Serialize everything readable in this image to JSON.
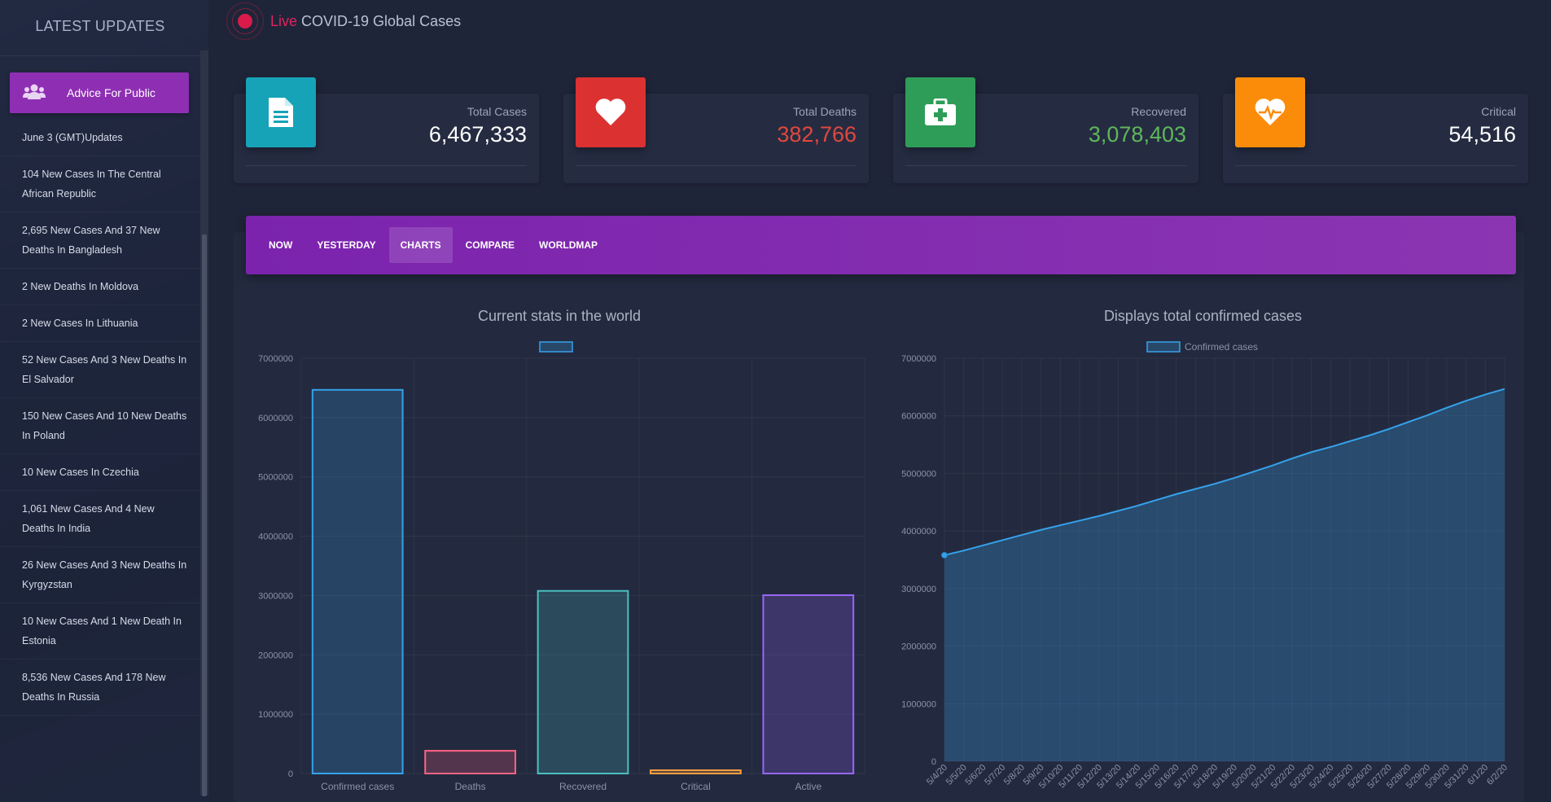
{
  "sidebar": {
    "title": "LATEST UPDATES",
    "advice_label": "Advice For Public",
    "items": [
      "June 3 (GMT)Updates",
      "104 New Cases In The Central African Republic",
      "2,695 New Cases And 37 New Deaths In Bangladesh",
      "2 New Deaths In Moldova",
      "2 New Cases In Lithuania",
      "52 New Cases And 3 New Deaths In El Salvador",
      "150 New Cases And 10 New Deaths In Poland",
      "10 New Cases In Czechia",
      "1,061 New Cases And 4 New Deaths In India",
      "26 New Cases And 3 New Deaths In Kyrgyzstan",
      "10 New Cases And 1 New Death In Estonia",
      "8,536 New Cases And 178 New Deaths In Russia"
    ]
  },
  "header": {
    "live": "Live",
    "title": "COVID-19 Global Cases"
  },
  "cards": [
    {
      "label": "Total Cases",
      "value": "6,467,333",
      "color": "#16a3b8",
      "value_color": "#ffffff",
      "icon": "document-icon"
    },
    {
      "label": "Total Deaths",
      "value": "382,766",
      "color": "#dc3131",
      "value_color": "#e2473c",
      "icon": "heart-icon"
    },
    {
      "label": "Recovered",
      "value": "3,078,403",
      "color": "#2e9d58",
      "value_color": "#5fb75a",
      "icon": "medkit-icon"
    },
    {
      "label": "Critical",
      "value": "54,516",
      "color": "#fb8c0a",
      "value_color": "#ffffff",
      "icon": "heartbeat-icon"
    }
  ],
  "tabs": [
    {
      "label": "NOW",
      "active": false
    },
    {
      "label": "YESTERDAY",
      "active": false
    },
    {
      "label": "CHARTS",
      "active": true
    },
    {
      "label": "COMPARE",
      "active": false
    },
    {
      "label": "WORLDMAP",
      "active": false
    }
  ],
  "chart_data": [
    {
      "type": "bar",
      "title": "Current stats in the world",
      "legend": "",
      "categories": [
        "Confirmed cases",
        "Deaths",
        "Recovered",
        "Critical",
        "Active"
      ],
      "values": [
        6467333,
        382766,
        3078403,
        54516,
        3006164
      ],
      "colors": [
        "#36a2eb",
        "#ff6384",
        "#4bc0c0",
        "#ff9f40",
        "#9966ff"
      ],
      "ylim": [
        0,
        7000000
      ],
      "yticks": [
        0,
        1000000,
        2000000,
        3000000,
        4000000,
        5000000,
        6000000,
        7000000
      ]
    },
    {
      "type": "area",
      "title": "Displays total confirmed cases",
      "legend": "Confirmed cases",
      "color": "#36a2eb",
      "x": [
        "5/4/20",
        "5/5/20",
        "5/6/20",
        "5/7/20",
        "5/8/20",
        "5/9/20",
        "5/10/20",
        "5/11/20",
        "5/12/20",
        "5/13/20",
        "5/14/20",
        "5/15/20",
        "5/16/20",
        "5/17/20",
        "5/18/20",
        "5/19/20",
        "5/20/20",
        "5/21/20",
        "5/22/20",
        "5/23/20",
        "5/24/20",
        "5/25/20",
        "5/26/20",
        "5/27/20",
        "5/28/20",
        "5/29/20",
        "5/30/20",
        "5/31/20",
        "6/1/20",
        "6/2/20"
      ],
      "values": [
        3580000,
        3660000,
        3750000,
        3840000,
        3930000,
        4020000,
        4100000,
        4180000,
        4260000,
        4350000,
        4440000,
        4540000,
        4640000,
        4730000,
        4820000,
        4920000,
        5030000,
        5140000,
        5260000,
        5370000,
        5460000,
        5560000,
        5660000,
        5770000,
        5890000,
        6010000,
        6140000,
        6260000,
        6370000,
        6467000
      ],
      "ylim": [
        0,
        7000000
      ],
      "yticks": [
        0,
        1000000,
        2000000,
        3000000,
        4000000,
        5000000,
        6000000,
        7000000
      ]
    }
  ]
}
